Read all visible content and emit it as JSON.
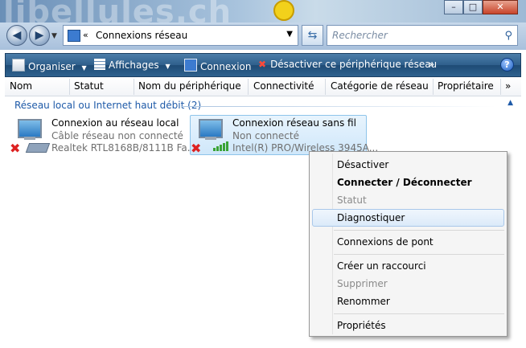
{
  "window": {
    "watermark": "libellules.ch",
    "buttons": {
      "minimize": "–",
      "maximize": "□",
      "close": "✕"
    }
  },
  "address_bar": {
    "chevron": "«",
    "path": "Connexions réseau",
    "search_placeholder": "Rechercher"
  },
  "toolbar": {
    "items": [
      {
        "label": "Organiser",
        "dropdown": "▼"
      },
      {
        "label": "Affichages",
        "dropdown": "▼"
      },
      {
        "label": "Connexion"
      },
      {
        "label": "Désactiver ce périphérique réseau"
      },
      {
        "label": "»"
      }
    ],
    "help": "?"
  },
  "columns": [
    "Nom",
    "Statut",
    "Nom du périphérique",
    "Connectivité",
    "Catégorie de réseau",
    "Propriétaire",
    "»"
  ],
  "group": {
    "label": "Réseau local ou Internet haut débit (2)",
    "collapse": "▲"
  },
  "connections": [
    {
      "name": "Connexion au réseau local",
      "status": "Câble réseau non connecté",
      "device": "Realtek RTL8168B/8111B Fa...",
      "icon": "wired-network-icon"
    },
    {
      "name": "Connexion réseau sans fil",
      "status": "Non connecté",
      "device": "Intel(R) PRO/Wireless 3945A...",
      "icon": "wireless-network-icon"
    }
  ],
  "context_menu": {
    "items": [
      {
        "label": "Désactiver",
        "state": "normal"
      },
      {
        "label": "Connecter / Déconnecter",
        "state": "bold"
      },
      {
        "label": "Statut",
        "state": "disabled"
      },
      {
        "label": "Diagnostiquer",
        "state": "hover"
      },
      {
        "label": "Connexions de pont",
        "state": "normal"
      },
      {
        "label": "Créer un raccourci",
        "state": "normal"
      },
      {
        "label": "Supprimer",
        "state": "disabled"
      },
      {
        "label": "Renommer",
        "state": "normal"
      },
      {
        "label": "Propriétés",
        "state": "normal"
      }
    ]
  },
  "colors": {
    "accent": "#1e5aa8",
    "toolbar": "#2f5f8c",
    "error": "#dd2222"
  }
}
